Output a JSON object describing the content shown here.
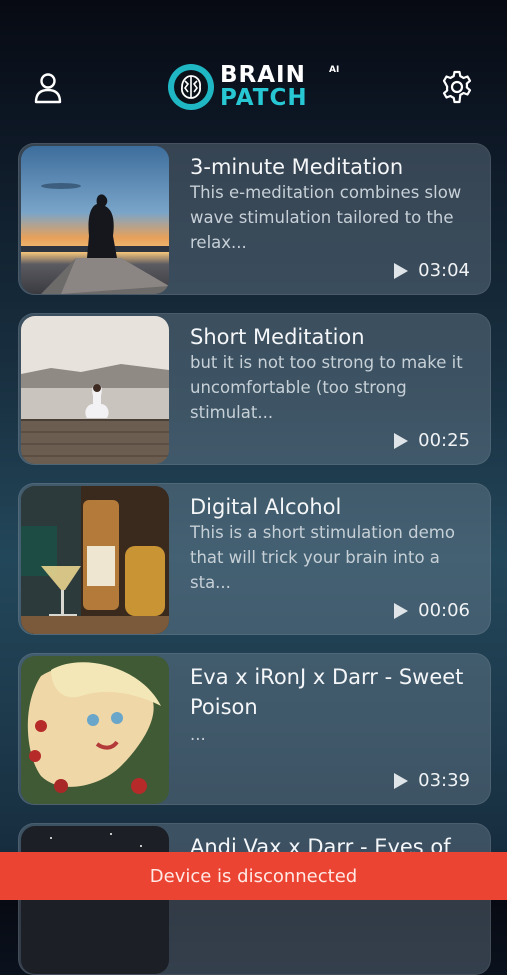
{
  "header": {
    "logo_line1": "BRAIN",
    "logo_line2": "PATCH",
    "logo_suffix": "AI",
    "profile_icon": "user-icon",
    "settings_icon": "gear-icon"
  },
  "tracks": [
    {
      "title": "3-minute Meditation",
      "description": "This e-meditation combines slow wave stimulation tailored to the relax...",
      "duration": "03:04",
      "thumbnail": "sunset-meditation"
    },
    {
      "title": "Short Meditation",
      "description": "but it is not too strong to make it uncomfortable (too strong stimulat...",
      "duration": "00:25",
      "thumbnail": "lake-meditation"
    },
    {
      "title": "Digital Alcohol",
      "description": "This is a short stimulation demo that will trick your brain into a sta...",
      "duration": "00:06",
      "thumbnail": "cocktail"
    },
    {
      "title": "Eva x iRonJ x Darr - Sweet Poison",
      "description": "...",
      "duration": "03:39",
      "thumbnail": "album-cover"
    },
    {
      "title": "Andi Vax x Darr - Eyes of the",
      "description": "",
      "duration": "",
      "thumbnail": "night-sky"
    }
  ],
  "status": {
    "message": "Device is disconnected",
    "color": "#ec4433"
  },
  "colors": {
    "accent": "#27c8d3"
  }
}
